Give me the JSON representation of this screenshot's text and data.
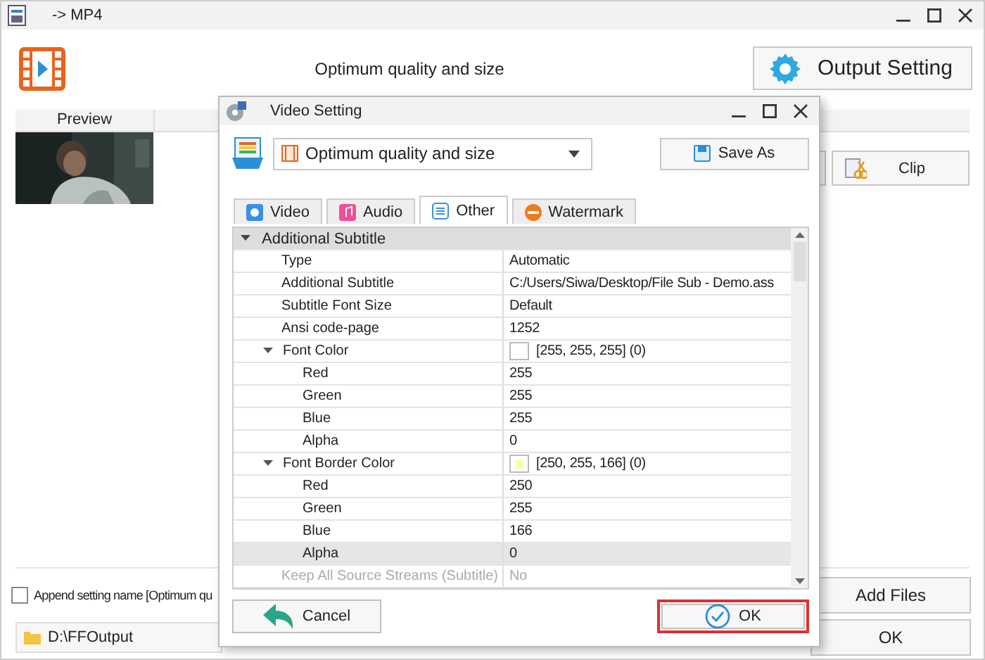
{
  "window": {
    "title": "-> MP4"
  },
  "header": {
    "profile": "Optimum quality and size",
    "output_button": "Output Setting"
  },
  "file_list": {
    "columns": [
      "Preview"
    ],
    "clip_button": "Clip"
  },
  "append_option": {
    "label": "Append setting name [Optimum qu",
    "checked": false
  },
  "output_folder": "D:\\FFOutput",
  "buttons": {
    "add_files": "Add Files",
    "ok": "OK"
  },
  "dialog": {
    "title": "Video Setting",
    "preset": "Optimum quality and size",
    "save_as": "Save As",
    "tabs": [
      {
        "label": "Video",
        "kind": "video",
        "selected": false
      },
      {
        "label": "Audio",
        "kind": "audio",
        "selected": false
      },
      {
        "label": "Other",
        "kind": "other",
        "selected": true
      },
      {
        "label": "Watermark",
        "kind": "watermark",
        "selected": false
      }
    ],
    "properties": [
      {
        "label": "Additional Subtitle",
        "kind": "category",
        "expanded": true,
        "children": [
          {
            "label": "Type",
            "value": "Automatic",
            "selected": false,
            "disabled": false
          },
          {
            "label": "Additional Subtitle",
            "value": "C:/Users/Siwa/Desktop/File Sub - Demo.ass",
            "selected": false,
            "disabled": false
          },
          {
            "label": "Subtitle Font Size",
            "value": "Default",
            "selected": false,
            "disabled": false
          },
          {
            "label": "Ansi code-page",
            "value": "1252",
            "selected": false,
            "disabled": false
          },
          {
            "label": "Font Color",
            "value": "[255, 255, 255] (0)",
            "color": "#ffffff",
            "expanded": true,
            "selected": false,
            "disabled": false,
            "children": [
              {
                "label": "Red",
                "value": "255",
                "selected": false,
                "disabled": false
              },
              {
                "label": "Green",
                "value": "255",
                "selected": false,
                "disabled": false
              },
              {
                "label": "Blue",
                "value": "255",
                "selected": false,
                "disabled": false
              },
              {
                "label": "Alpha",
                "value": "0",
                "selected": false,
                "disabled": false
              }
            ]
          },
          {
            "label": "Font Border Color",
            "value": "[250, 255, 166] (0)",
            "color": "#faffa6",
            "expanded": true,
            "selected": false,
            "disabled": false,
            "children": [
              {
                "label": "Red",
                "value": "250",
                "selected": false,
                "disabled": false
              },
              {
                "label": "Green",
                "value": "255",
                "selected": false,
                "disabled": false
              },
              {
                "label": "Blue",
                "value": "166",
                "selected": false,
                "disabled": false
              },
              {
                "label": "Alpha",
                "value": "0",
                "selected": true,
                "disabled": false
              }
            ]
          },
          {
            "label": "Keep All Source Streams (Subtitle)",
            "value": "No",
            "selected": false,
            "disabled": true
          }
        ]
      }
    ],
    "cancel": "Cancel",
    "ok": {
      "label": "OK",
      "highlighted": true
    }
  }
}
